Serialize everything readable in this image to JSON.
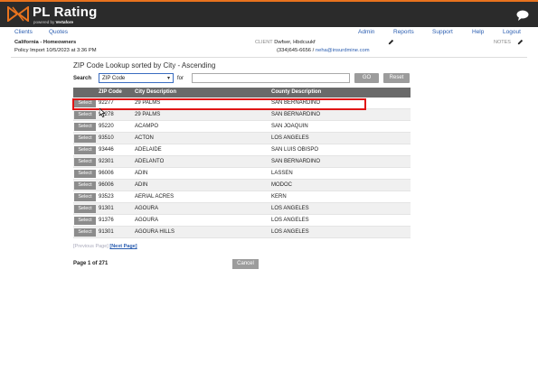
{
  "header": {
    "brand": "PL Rating",
    "powered_prefix": "powered by",
    "powered_company": "Vertafore"
  },
  "nav": {
    "clients": "Clients",
    "quotes": "Quotes",
    "admin": "Admin",
    "reports": "Reports",
    "support": "Support",
    "help": "Help",
    "logout": "Logout"
  },
  "policy": {
    "line": "California - Homeowners",
    "import": "Policy Import 10/5/2023 at 3:36 PM"
  },
  "client": {
    "label": "CLIENT",
    "name": "Dwfser, Hbdcuukf",
    "phone": "(334)645-6656 /",
    "email": "neha@insurdmine.com"
  },
  "notes_label": "NOTES",
  "lookup": {
    "title": "ZIP Code Lookup sorted by City - Ascending",
    "search_label": "Search",
    "search_option": "ZIP Code",
    "for_label": "for",
    "for_value": "",
    "go": "GO",
    "reset": "Reset"
  },
  "table": {
    "headers": {
      "zip": "ZIP Code",
      "city": "City Description",
      "county": "County Description"
    },
    "select_label": "Select",
    "rows": [
      {
        "zip": "92277",
        "city": "29 PALMS",
        "county": "SAN BERNARDINO"
      },
      {
        "zip": "92278",
        "city": "29 PALMS",
        "county": "SAN BERNARDINO"
      },
      {
        "zip": "95220",
        "city": "ACAMPO",
        "county": "SAN JOAQUIN"
      },
      {
        "zip": "93510",
        "city": "ACTON",
        "county": "LOS ANGELES"
      },
      {
        "zip": "93446",
        "city": "ADELAIDE",
        "county": "SAN LUIS OBISPO"
      },
      {
        "zip": "92301",
        "city": "ADELANTO",
        "county": "SAN BERNARDINO"
      },
      {
        "zip": "96006",
        "city": "ADIN",
        "county": "LASSEN"
      },
      {
        "zip": "96006",
        "city": "ADIN",
        "county": "MODOC"
      },
      {
        "zip": "93523",
        "city": "AERIAL ACRES",
        "county": "KERN"
      },
      {
        "zip": "91301",
        "city": "AGOURA",
        "county": "LOS ANGELES"
      },
      {
        "zip": "91376",
        "city": "AGOURA",
        "county": "LOS ANGELES"
      },
      {
        "zip": "91301",
        "city": "AGOURA HILLS",
        "county": "LOS ANGELES"
      }
    ]
  },
  "pager": {
    "prev": "[Previous Page]",
    "next": "[Next Page]",
    "page_info": "Page 1 of 271",
    "cancel": "Cancel"
  },
  "colors": {
    "accent": "#e8731e",
    "header_bg": "#2b2b2b",
    "link": "#2a5db0",
    "highlight": "#e01515"
  }
}
